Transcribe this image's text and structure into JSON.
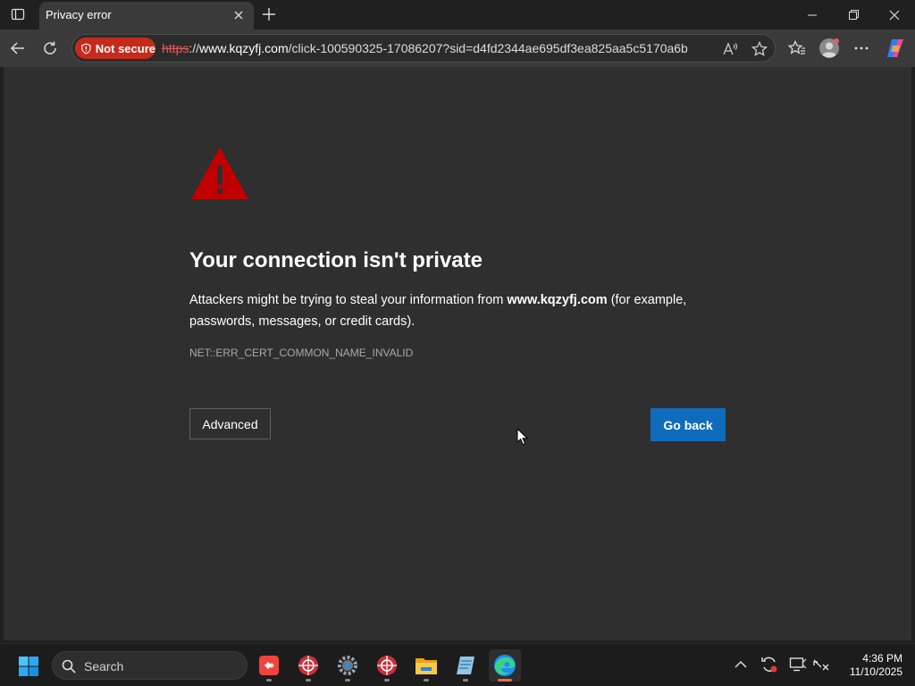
{
  "tab": {
    "title": "Privacy error"
  },
  "address_bar": {
    "security_label": "Not secure",
    "url_scheme": "https",
    "url_separator": "://",
    "url_host": "www.kqzyfj.com",
    "url_path": "/click-100590325-17086207?sid=d4fd2344ae695df3ea825aa5c5170a6b"
  },
  "page": {
    "heading": "Your connection isn't private",
    "description_before": "Attackers might be trying to steal your information from ",
    "description_host": "www.kqzyfj.com",
    "description_after": " (for example, passwords, messages, or credit cards).",
    "error_code": "NET::ERR_CERT_COMMON_NAME_INVALID",
    "advanced_label": "Advanced",
    "go_back_label": "Go back"
  },
  "taskbar": {
    "search_label": "Search",
    "time": "4:36 PM",
    "date": "11/10/2025"
  },
  "colors": {
    "warning_red": "#c00000",
    "not_secure_red": "#c42b1c",
    "go_back_blue": "#0f6cbd",
    "page_background": "#2f2f2f"
  },
  "icons": {
    "tab_actions": "tab-actions-icon",
    "close_tab": "close-icon",
    "new_tab": "plus-icon",
    "minimize": "minimize-icon",
    "restore": "restore-icon",
    "close_window": "close-icon",
    "back": "back-arrow-icon",
    "refresh": "refresh-icon",
    "not_secure": "shield-warning-icon",
    "read_aloud": "read-aloud-icon",
    "favorite": "star-icon",
    "favorites": "favorites-icon",
    "profile": "profile-icon",
    "more": "more-icon",
    "copilot": "copilot-icon",
    "warning": "warning-triangle-icon",
    "start": "windows-icon",
    "search": "search-icon",
    "tray_overflow": "chevron-up-icon",
    "sync": "sync-icon",
    "display": "display-icon",
    "network": "network-icon"
  }
}
